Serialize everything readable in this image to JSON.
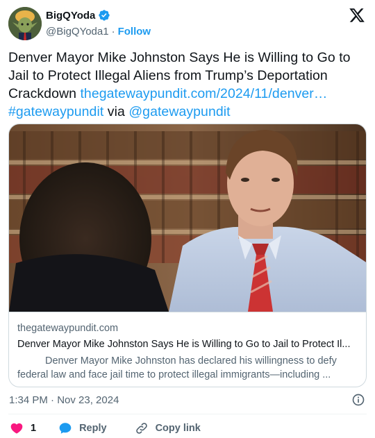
{
  "author": {
    "display_name": "BigQYoda",
    "handle": "@BigQYoda1",
    "separator": "·",
    "follow_label": "Follow"
  },
  "tweet": {
    "text_part1": "Denver Mayor Mike Johnston Says He is Willing to Go to Jail to Protect Illegal Aliens from Trump’s Deportation Crackdown ",
    "link": "thegatewaypundit.com/2024/11/denver…",
    "hashtag": "#gatewaypundit",
    "via": " via ",
    "mention": "@gatewaypundit"
  },
  "card": {
    "domain": "thegatewaypundit.com",
    "title": "Denver Mayor Mike Johnston Says He is Willing to Go to Jail to Protect Il...",
    "description": "Denver Mayor Mike Johnston has declared his willingness to defy federal law and face jail time to protect illegal immigrants—including ..."
  },
  "timestamp": "1:34 PM · Nov 23, 2024",
  "actions": {
    "like_count": "1",
    "reply_label": "Reply",
    "copy_link_label": "Copy link"
  },
  "colors": {
    "accent": "#1d9bf0",
    "like": "#f91880",
    "text": "#0f1419",
    "secondary": "#536471"
  }
}
